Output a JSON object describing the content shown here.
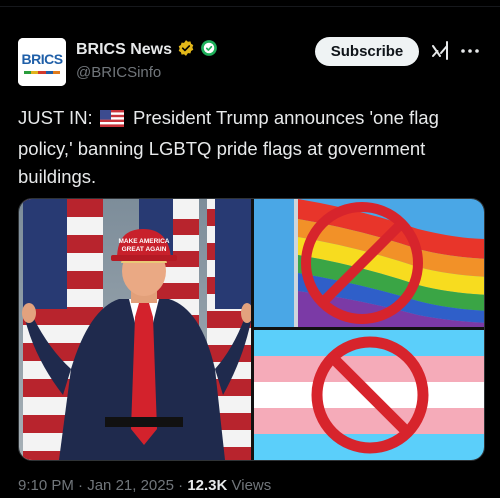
{
  "account": {
    "display_name": "BRICS News",
    "handle": "@BRICSinfo",
    "avatar_text": "BRICS"
  },
  "actions": {
    "subscribe_label": "Subscribe"
  },
  "tweet": {
    "prefix": "JUST IN:",
    "body": "President Trump announces 'one flag policy,' banning LGBTQ pride flags at government buildings."
  },
  "media": {
    "cap_text_line1": "MAKE AMERICA",
    "cap_text_line2": "GREAT AGAIN"
  },
  "meta": {
    "time": "9:10 PM",
    "sep1": " · ",
    "date": "Jan 21, 2025",
    "sep2": " · ",
    "views_count": "12.3K",
    "views_label": " Views"
  },
  "icons": [
    "verified-badge-icon",
    "sponsor-badge-icon",
    "grok-icon",
    "more-icon",
    "us-flag-emoji-icon",
    "prohibited-icon"
  ],
  "colors": {
    "background": "#000000",
    "text_primary": "#e7e9ea",
    "text_secondary": "#71767b",
    "verified_gold": "#e2b719",
    "prohibit_red": "#d7242c"
  }
}
